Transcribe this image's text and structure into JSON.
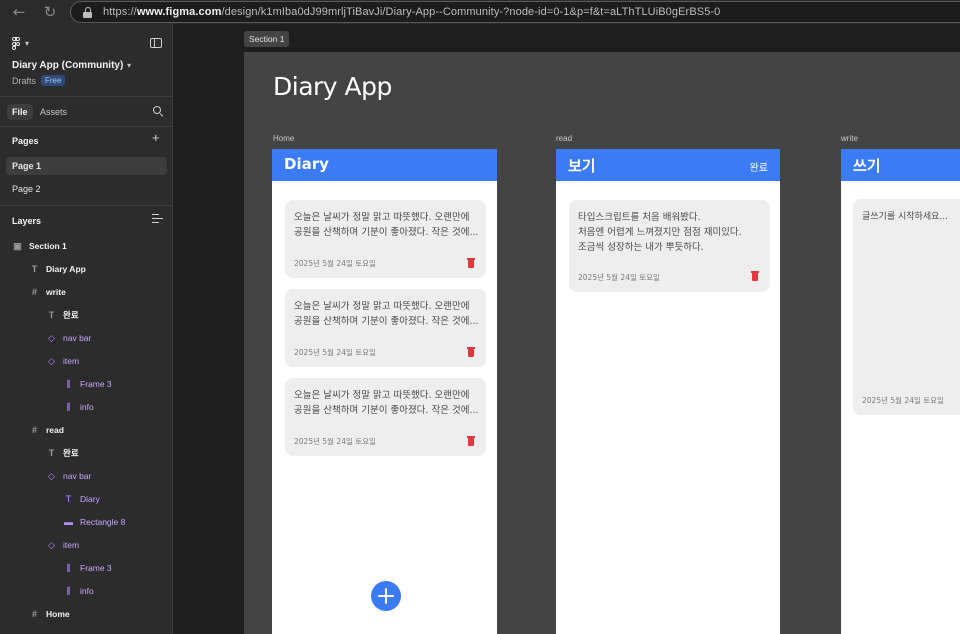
{
  "browser": {
    "url_prefix": "https://",
    "url_domain": "www.figma.com",
    "url_path": "/design/k1mIba0dJ99mrljTiBavJi/Diary-App--Community-?node-id=0-1&p=f&t=aLThTLUiB0gErBS5-0"
  },
  "sidebar": {
    "file_title": "Diary App (Community)",
    "drafts_label": "Drafts",
    "plan_badge": "Free",
    "tabs": {
      "file": "File",
      "assets": "Assets"
    },
    "pages_heading": "Pages",
    "pages": [
      "Page 1",
      "Page 2"
    ],
    "layers_heading": "Layers",
    "layers": [
      {
        "label": "Section 1",
        "icon": "section-icon"
      },
      {
        "label": "Diary App",
        "icon": "text-icon"
      },
      {
        "label": "write",
        "icon": "frame-icon"
      },
      {
        "label": "완료",
        "icon": "text-icon"
      },
      {
        "label": "nav bar",
        "icon": "component-instance-icon"
      },
      {
        "label": "item",
        "icon": "component-instance-icon"
      },
      {
        "label": "Frame 3",
        "icon": "auto-layout-icon"
      },
      {
        "label": "info",
        "icon": "auto-layout-icon"
      },
      {
        "label": "read",
        "icon": "frame-icon"
      },
      {
        "label": "완료",
        "icon": "text-icon"
      },
      {
        "label": "nav bar",
        "icon": "component-instance-icon"
      },
      {
        "label": "Diary",
        "icon": "text-icon"
      },
      {
        "label": "Rectangle 8",
        "icon": "rectangle-icon"
      },
      {
        "label": "item",
        "icon": "component-instance-icon"
      },
      {
        "label": "Frame 3",
        "icon": "auto-layout-icon"
      },
      {
        "label": "info",
        "icon": "auto-layout-icon"
      },
      {
        "label": "Home",
        "icon": "frame-icon"
      }
    ]
  },
  "canvas": {
    "section_tag": "Section 1",
    "app_title": "Diary App",
    "frames": {
      "home": {
        "label": "Home",
        "bar_title": "Diary",
        "cards": [
          {
            "text": "오늘은 날씨가 정말 맑고 따뜻했다. 오랜만에\n공원을 산책하며 기분이 좋아졌다. 작은 것에...",
            "date": "2025년 5월 24일 토요일"
          },
          {
            "text": "오늘은 날씨가 정말 맑고 따뜻했다. 오랜만에\n공원을 산책하며 기분이 좋아졌다. 작은 것에...",
            "date": "2025년 5월 24일 토요일"
          },
          {
            "text": "오늘은 날씨가 정말 맑고 따뜻했다. 오랜만에\n공원을 산책하며 기분이 좋아졌다. 작은 것에...",
            "date": "2025년 5월 24일 토요일"
          }
        ]
      },
      "read": {
        "label": "read",
        "bar_title": "보기",
        "bar_action": "완료",
        "card": {
          "text": "타입스크립트를 처음 배워봤다.\n처음엔 어렵게 느껴졌지만 점점 재미있다.\n조금씩 성장하는 내가 뿌듯하다.",
          "date": "2025년 5월 24일 토요일"
        }
      },
      "write": {
        "label": "write",
        "bar_title": "쓰기",
        "placeholder": "글쓰기를 시작하세요...",
        "date": "2025년 5월 24일 토요일"
      }
    }
  },
  "colors": {
    "accent_blue": "#3b7bf6",
    "delete_red": "#e0393e",
    "canvas_section": "#444444"
  }
}
